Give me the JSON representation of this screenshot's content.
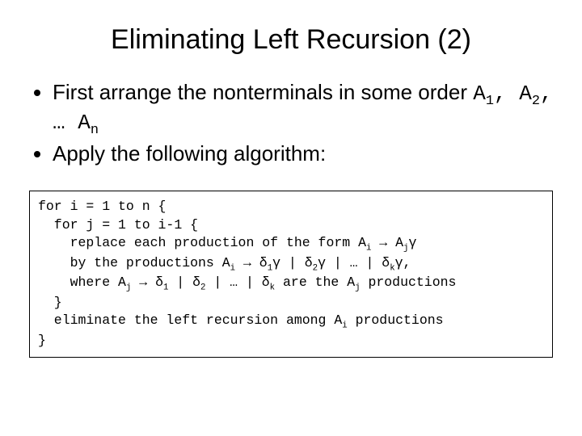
{
  "title": "Eliminating Left Recursion (2)",
  "bullets": {
    "b1a": "First arrange the nonterminals in some order ",
    "b1b_A1": "A",
    "b1b_1": "1",
    "b1b_c1": ", ",
    "b1b_A2": "A",
    "b1b_2": "2",
    "b1b_c2": ", … ",
    "b1b_An": "A",
    "b1b_n": "n",
    "b2": "Apply the following algorithm:"
  },
  "code": {
    "l1": "for i = 1 to n {",
    "l2": "  for j = 1 to i-1 {",
    "l3a": "    replace each production of the form A",
    "l3_i": "i",
    "l3b": " → A",
    "l3_j": "j",
    "l3c": "γ",
    "l4a": "    by the productions A",
    "l4_i": "i",
    "l4b": " → δ",
    "l4_1": "1",
    "l4c": "γ | δ",
    "l4_2": "2",
    "l4d": "γ | … | δ",
    "l4_k": "k",
    "l4e": "γ,",
    "l5a": "    where A",
    "l5_j": "j",
    "l5b": " → δ",
    "l5_1": "1",
    "l5c": " | δ",
    "l5_2": "2",
    "l5d": " | … | δ",
    "l5_k": "k",
    "l5e": " are the A",
    "l5_j2": "j",
    "l5f": " productions",
    "l6": "  }",
    "l7a": "  eliminate the left recursion among A",
    "l7_i": "i",
    "l7b": " productions",
    "l8": "}"
  }
}
